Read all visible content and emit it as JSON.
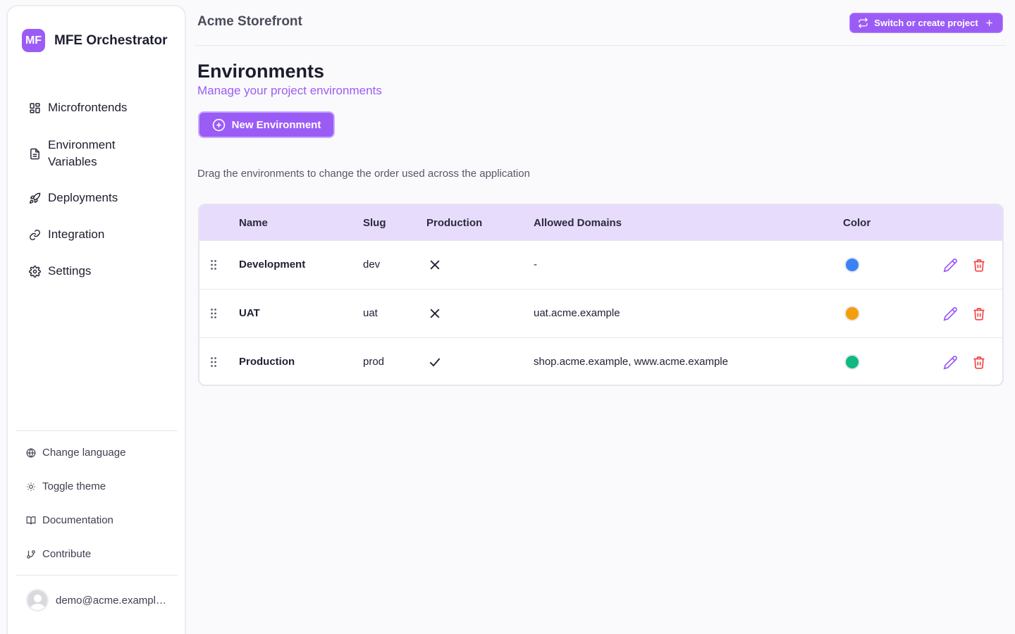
{
  "brand": {
    "logo_text": "MF",
    "name": "MFE Orchestrator"
  },
  "sidebar": {
    "nav": [
      {
        "label": "Microfrontends",
        "icon": "grid-icon"
      },
      {
        "label": "Environment Variables",
        "icon": "file-text-icon"
      },
      {
        "label": "Deployments",
        "icon": "rocket-icon"
      },
      {
        "label": "Integration",
        "icon": "link-icon"
      },
      {
        "label": "Settings",
        "icon": "gear-icon"
      }
    ],
    "utilities": [
      {
        "label": "Change language",
        "icon": "globe-icon"
      },
      {
        "label": "Toggle theme",
        "icon": "sun-icon"
      },
      {
        "label": "Documentation",
        "icon": "book-icon"
      },
      {
        "label": "Contribute",
        "icon": "git-branch-icon"
      }
    ],
    "user_email": "demo@acme.example.com"
  },
  "header": {
    "project_name": "Acme Storefront",
    "switch_button_label": "Switch or create project"
  },
  "page": {
    "title": "Environments",
    "subtitle": "Manage your project environments",
    "new_button_label": "New Environment",
    "hint": "Drag the environments to change the order used across the application"
  },
  "table": {
    "headers": {
      "name": "Name",
      "slug": "Slug",
      "production": "Production",
      "domains": "Allowed Domains",
      "color": "Color"
    },
    "rows": [
      {
        "name": "Development",
        "slug": "dev",
        "production": false,
        "domains": "-",
        "color": "#3b82f6"
      },
      {
        "name": "UAT",
        "slug": "uat",
        "production": false,
        "domains": "uat.acme.example",
        "color": "#f59e0b"
      },
      {
        "name": "Production",
        "slug": "prod",
        "production": true,
        "domains": "shop.acme.example, www.acme.example",
        "color": "#10b981"
      }
    ]
  },
  "colors": {
    "accent": "#9b5cf6",
    "header_bg": "#e7dcfb",
    "danger": "#ef4444"
  }
}
